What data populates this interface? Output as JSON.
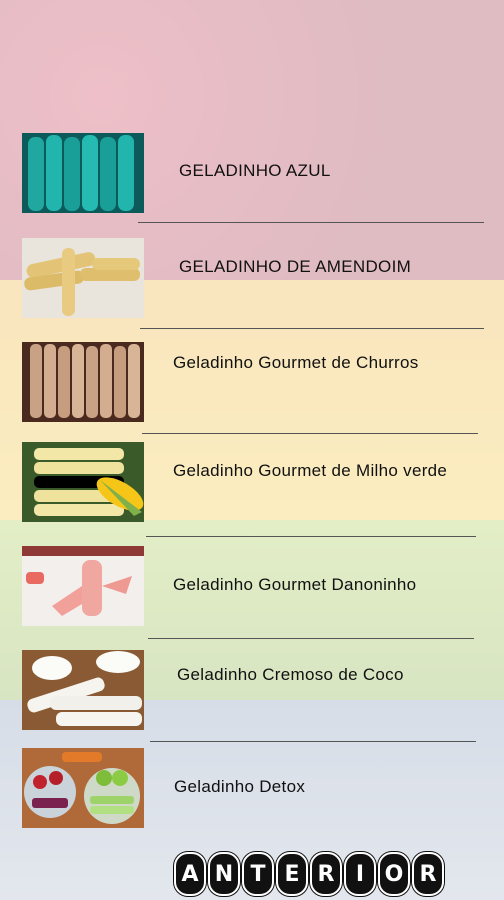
{
  "items": [
    {
      "label": "GELADINHO AZUL",
      "thumb": "blue-popsicles"
    },
    {
      "label": "GELADINHO DE AMENDOIM",
      "thumb": "peanut-popsicles"
    },
    {
      "label": "Geladinho Gourmet  de Churros",
      "thumb": "churros-popsicles"
    },
    {
      "label": "Geladinho Gourmet de Milho verde",
      "thumb": "corn-popsicles"
    },
    {
      "label": "Geladinho Gourmet Danoninho",
      "thumb": "danoninho-popsicles"
    },
    {
      "label": "Geladinho Cremoso de Coco",
      "thumb": "coconut-popsicles"
    },
    {
      "label": "Geladinho Detox",
      "thumb": "detox-popsicles"
    }
  ],
  "footer": {
    "anterior_button": "ANTERIOR"
  }
}
